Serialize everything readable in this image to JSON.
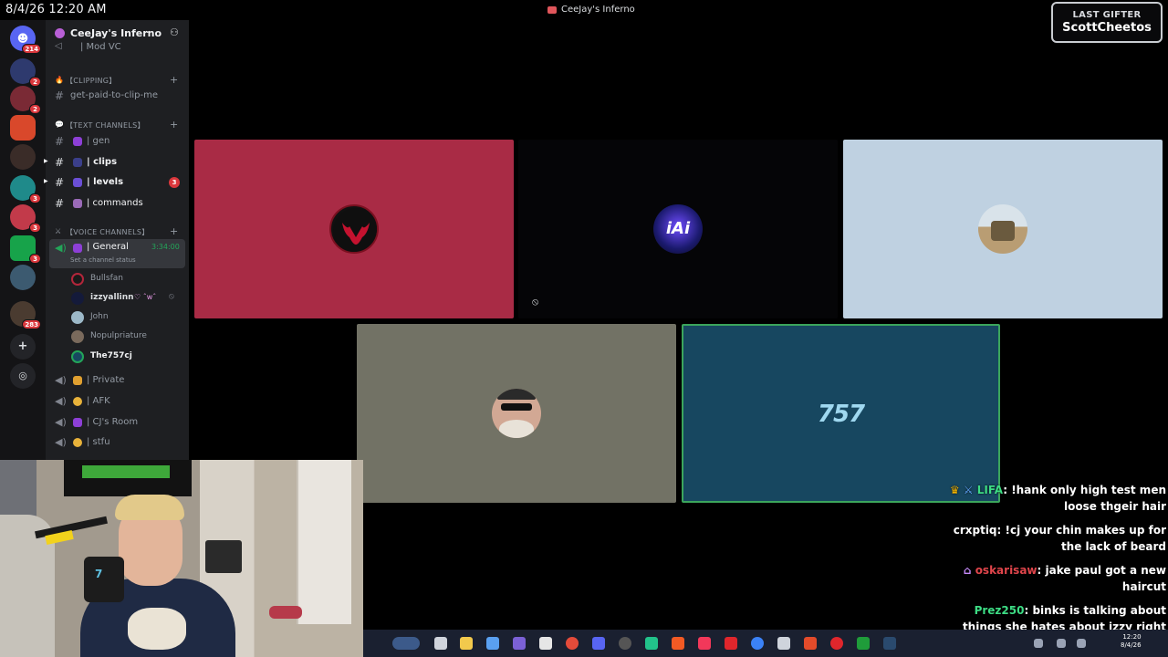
{
  "top": {
    "clock": "8/4/26 12:20 AM",
    "window_title": "CeeJay's Inferno",
    "gifter_label": "LAST GIFTER",
    "gifter_name": "ScottCheetos"
  },
  "rail": {
    "badges": [
      "214",
      "2",
      "2",
      "3",
      "3",
      "3",
      "283"
    ]
  },
  "server": {
    "name": "CeeJay's Inferno"
  },
  "channels": {
    "mod_vc": "| Mod VC",
    "clipping_cat": "【CLIPPING】",
    "get_paid": "get-paid-to-clip-me",
    "text_cat": "【TEXT CHANNELS】",
    "gen": "| gen",
    "clips": "| clips",
    "levels": "| levels",
    "levels_mentions": "3",
    "commands": "| commands",
    "voice_cat": "【VOICE CHANNELS】",
    "general": "| General",
    "general_timer": "3:34:00",
    "general_status": "Set a channel status",
    "private": "| Private",
    "afk": "| AFK",
    "cjs_room": "| CJ's Room",
    "stfu": "| stfu"
  },
  "voice_users": [
    {
      "name": "Bullsfan"
    },
    {
      "name": "izzyallinn",
      "suffix": "♡ ˆwˆ"
    },
    {
      "name": "John"
    },
    {
      "name": "Nopulpriature"
    },
    {
      "name": "The757cj"
    }
  ],
  "chat": [
    {
      "user": "LIFA",
      "user_color": "#3ddc84",
      "text": ": !hank only high test men loose thgeir hair"
    },
    {
      "user": "crxptiq",
      "user_color": "#ffffff",
      "text": ": !cj your chin makes up for the lack of beard"
    },
    {
      "user": "oskarisaw",
      "user_color": "#e0454b",
      "text": ": jake paul got a new haircut"
    },
    {
      "user": "Prez250",
      "user_color": "#3ddc84",
      "text": ": binks is talking about things she hates about izzy right now."
    }
  ],
  "taskbar": {
    "time": "12:20",
    "date": "8/4/26"
  },
  "colors": {
    "tile_bulls": "#a92b45",
    "tile_dark": "#050507",
    "tile_sky": "#bfd1e1",
    "tile_gray": "#727265",
    "tile_blue": "#174760",
    "speaking_border": "#3ba55c"
  }
}
